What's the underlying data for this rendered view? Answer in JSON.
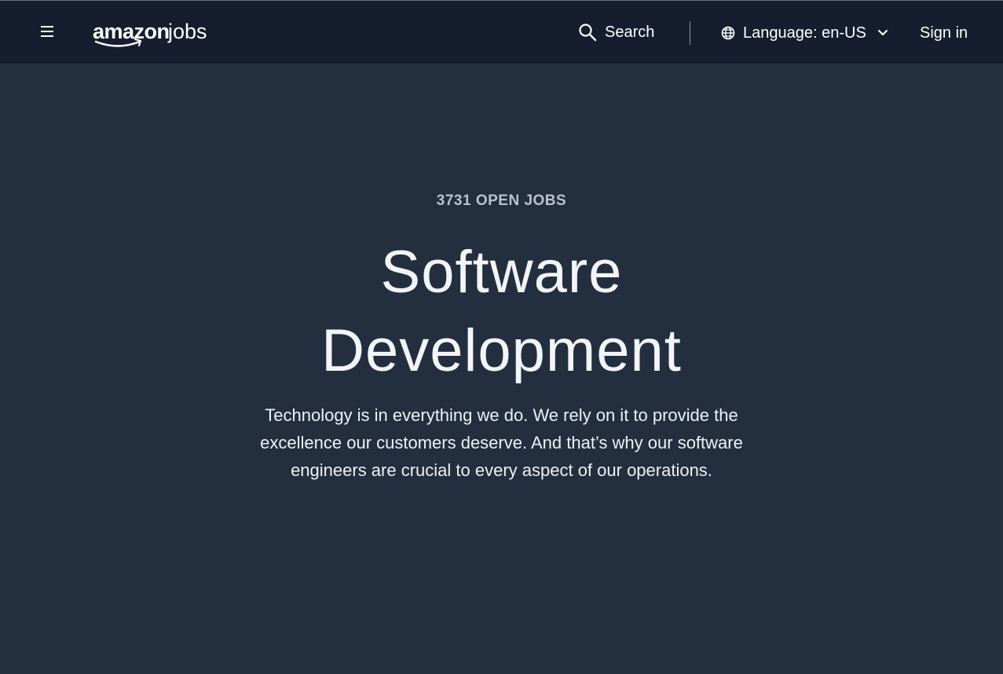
{
  "header": {
    "logo_primary": "amazon",
    "logo_secondary": "jobs",
    "search_label": "Search",
    "language_label": "Language: en-US",
    "signin_label": "Sign in"
  },
  "hero": {
    "open_jobs": "3731 OPEN JOBS",
    "title_line1": "Software",
    "title_line2": "Development",
    "description": "Technology is in everything we do. We rely on it to provide the excellence our customers deserve. And that’s why our software engineers are crucial to every aspect of our operations."
  },
  "icons": {
    "menu": "hamburger-menu-icon",
    "search": "search-icon",
    "language": "globe-icon",
    "dropdown": "chevron-down-icon"
  },
  "colors": {
    "header_bg": "#161d2e",
    "page_bg": "#232f3e",
    "text": "#ffffff",
    "muted_text": "#b9c2cd"
  }
}
